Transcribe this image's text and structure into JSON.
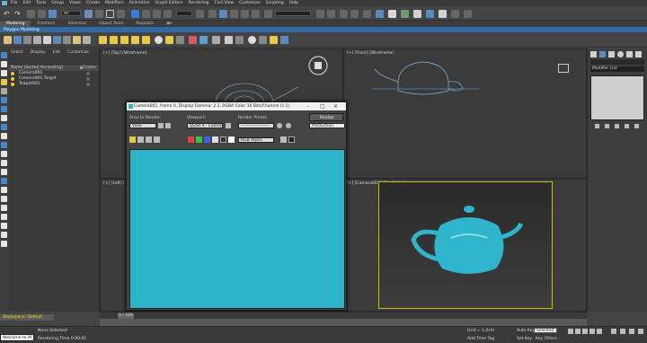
{
  "menu": [
    "File",
    "Edit",
    "Tools",
    "Group",
    "Views",
    "Create",
    "Modifiers",
    "Animation",
    "Graph Editors",
    "Rendering",
    "Civil View",
    "Customize",
    "Scripting",
    "Help"
  ],
  "toolbar": {
    "selection_filter": "All"
  },
  "ribbon": {
    "tabs": [
      "Modeling",
      "Freeform",
      "Selection",
      "Object Paint",
      "Populate"
    ],
    "active_tab": "Modeling",
    "subtab": "Polygon Modeling"
  },
  "scene_explorer": {
    "menu": [
      "Select",
      "Display",
      "Edit",
      "Customize"
    ],
    "column_name": "Name (Sorted Ascending)",
    "column_frozen": "▲Frozen",
    "rows": [
      "Camera001",
      "Camera001.Target",
      "Teapot001"
    ]
  },
  "viewports": {
    "top": "[+] [Top] [Wireframe]",
    "front": "[+] [Front] [Wireframe]",
    "left": "[+] [Left] [",
    "camera": "[+] [Camera001] [Realistic ]"
  },
  "render_window": {
    "title": "Camera001, frame 0, Display Gamma: 2.2, RGBA Color 16 Bits/Channel (1:1)",
    "area_label": "Area to Render:",
    "area_value": "View",
    "viewport_label": "Viewport:",
    "viewport_value": "Quad 4 - Camera(",
    "preset_label": "Render Preset:",
    "preset_value": "-------------------",
    "render_button": "Render",
    "production_value": "Production",
    "channel_value": "RGB Alpha"
  },
  "command_panel": {
    "modifier_list": "Modifier List"
  },
  "timeline": {
    "frame_display": "0 / 100"
  },
  "status": {
    "workspace": "Workspace: Default",
    "none_selected": "None Selected",
    "rendering_time": "Rendering Time  0:00:01",
    "maxscript": "Welcome to M",
    "grid": "Grid = 1.0cm",
    "add_time_tag": "Add Time Tag",
    "auto_key": "Auto Key",
    "set_key": "Set Key",
    "selected": "Selected",
    "key_filters": "Key Filters..."
  },
  "colors": {
    "render_bg": "#2cb4c9",
    "teapot": "#2fb6cc",
    "viewport_bg": "#3b3b3b",
    "wireframe": "#8ab4d8",
    "accent_blue": "#2f6aa3",
    "camera_frame": "#c8c000"
  }
}
